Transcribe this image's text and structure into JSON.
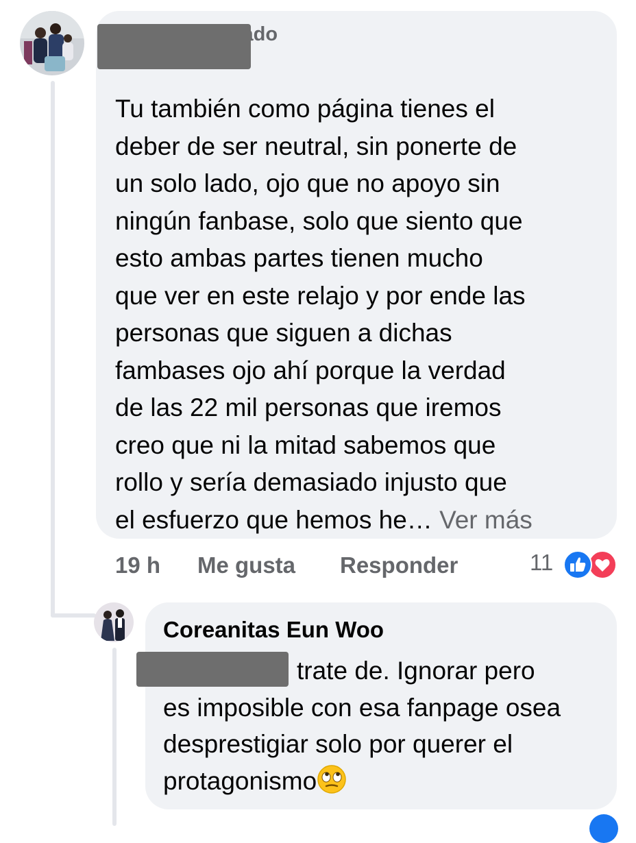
{
  "main_comment": {
    "badge": "Fan destacado",
    "text": "Tu también como página tienes el\ndeber de ser neutral, sin ponerte de\nun solo lado, ojo que no apoyo sin\nningún fanbase, solo que siento que\nesto ambas partes tienen mucho\nque ver en este relajo y por ende las\npersonas que siguen a dichas\nfambases ojo ahí porque la verdad\nde las 22 mil personas que iremos\ncreo que ni la mitad sabemos que\nrollo y sería demasiado injusto que\nel esfuerzo que hemos he… ",
    "see_more": "Ver más",
    "time": "19 h",
    "like_label": "Me gusta",
    "reply_label": "Responder",
    "reaction_count": "11",
    "reactions": [
      "like-icon",
      "love-icon"
    ]
  },
  "reply": {
    "author": "Coreanitas Eun Woo",
    "text_line1": "trate de. Ignorar pero",
    "text_rest": "es imposible con esa fanpage osea desprestigiar solo por querer el protagonismo",
    "emoji": "face-with-rolling-eyes-emoji"
  },
  "colors": {
    "bubble": "#f0f2f5",
    "secondary_text": "#65676b",
    "like_blue": "#1877f2",
    "love_red": "#f33e58"
  }
}
